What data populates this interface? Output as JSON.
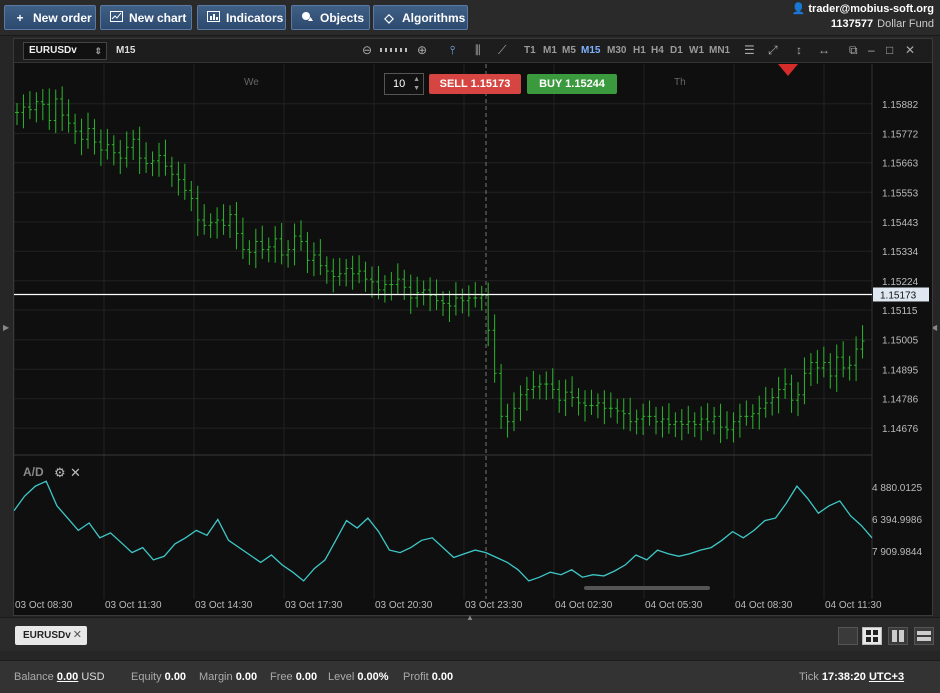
{
  "toolbar": {
    "buttons": [
      {
        "label": "New order",
        "icon": "plus-icon"
      },
      {
        "label": "New chart",
        "icon": "chart-icon"
      },
      {
        "label": "Indicators",
        "icon": "indicators-icon"
      },
      {
        "label": "Objects",
        "icon": "objects-icon"
      },
      {
        "label": "Algorithms",
        "icon": "algorithms-icon"
      }
    ],
    "account": {
      "user": "trader@mobius-soft.org",
      "number": "1137577",
      "fund": "Dollar Fund"
    }
  },
  "chart": {
    "symbol": "EURUSDv",
    "timeframe": "M15",
    "timeframes": [
      "T1",
      "M1",
      "M5",
      "M15",
      "M30",
      "H1",
      "H4",
      "D1",
      "W1",
      "MN1"
    ],
    "active_timeframe": "M15",
    "day_labels": [
      "We",
      "Th"
    ],
    "trade": {
      "lots": "10",
      "sell_label": "SELL",
      "sell_price": "1.15173",
      "buy_label": "BUY",
      "buy_price": "1.15244"
    },
    "indicator": "A/D",
    "colors": {
      "bars": "#2db52d",
      "indicator": "#3ec7c7",
      "bid_line": "#ffffff",
      "sell": "#d64541",
      "buy": "#3c9a3e",
      "active_tf": "#7fb2ff"
    }
  },
  "chart_data": {
    "type": "bar",
    "title": "",
    "symbol": "EURUSDv",
    "timeframe": "M15",
    "price_axis_ticks": [
      "1.15882",
      "1.15772",
      "1.15663",
      "1.15553",
      "1.15443",
      "1.15334",
      "1.15224",
      "1.15115",
      "1.15005",
      "1.14895",
      "1.14786",
      "1.14676"
    ],
    "current_price": "1.15173",
    "ylim": [
      1.1458,
      1.1603
    ],
    "x_axis_ticks": [
      "03 Oct 08:30",
      "03 Oct 11:30",
      "03 Oct 14:30",
      "03 Oct 17:30",
      "03 Oct 20:30",
      "03 Oct 23:30",
      "04 Oct 02:30",
      "04 Oct 05:30",
      "04 Oct 08:30",
      "04 Oct 11:30"
    ],
    "close_series": [
      1.1585,
      1.1587,
      1.1586,
      1.1589,
      1.1588,
      1.1582,
      1.159,
      1.1584,
      1.1581,
      1.1578,
      1.1575,
      1.1579,
      1.1574,
      1.1571,
      1.1573,
      1.157,
      1.1568,
      1.1572,
      1.1575,
      1.1568,
      1.1566,
      1.1567,
      1.1569,
      1.1565,
      1.1562,
      1.156,
      1.1556,
      1.1553,
      1.1545,
      1.1543,
      1.1544,
      1.1545,
      1.1543,
      1.1547,
      1.154,
      1.1534,
      1.1533,
      1.1537,
      1.1534,
      1.1535,
      1.1538,
      1.1532,
      1.1534,
      1.1539,
      1.1537,
      1.153,
      1.1532,
      1.1528,
      1.1526,
      1.1524,
      1.1525,
      1.1527,
      1.1525,
      1.1526,
      1.1523,
      1.1522,
      1.1519,
      1.1521,
      1.1521,
      1.1523,
      1.152,
      1.1516,
      1.1518,
      1.1519,
      1.1517,
      1.1515,
      1.1514,
      1.1513,
      1.1516,
      1.1515,
      1.1516,
      1.1516,
      1.1517,
      1.1504,
      1.1488,
      1.1472,
      1.147,
      1.1475,
      1.148,
      1.1482,
      1.1483,
      1.1484,
      1.1484,
      1.1482,
      1.1478,
      1.1481,
      1.1479,
      1.1477,
      1.1476,
      1.1476,
      1.1477,
      1.1475,
      1.1475,
      1.1474,
      1.1473,
      1.147,
      1.1471,
      1.1472,
      1.1472,
      1.147,
      1.1471,
      1.1469,
      1.147,
      1.1469,
      1.147,
      1.1469,
      1.1471,
      1.147,
      1.1472,
      1.1468,
      1.1467,
      1.147,
      1.1472,
      1.1472,
      1.1473,
      1.1475,
      1.1477,
      1.1479,
      1.1482,
      1.1484,
      1.1478,
      1.148,
      1.1488,
      1.1492,
      1.149,
      1.1492,
      1.1487,
      1.1494,
      1.149,
      1.1491,
      1.1497,
      1.15
    ],
    "indicator": {
      "name": "A/D",
      "axis_ticks": [
        "4 880.0125",
        "6 394.9986",
        "7 909.9844"
      ],
      "values": [
        0.62,
        0.74,
        0.82,
        0.86,
        0.66,
        0.56,
        0.46,
        0.52,
        0.4,
        0.44,
        0.36,
        0.28,
        0.32,
        0.22,
        0.25,
        0.35,
        0.4,
        0.46,
        0.42,
        0.55,
        0.38,
        0.32,
        0.26,
        0.2,
        0.26,
        0.18,
        0.12,
        0.05,
        0.15,
        0.22,
        0.38,
        0.54,
        0.48,
        0.56,
        0.45,
        0.3,
        0.28,
        0.32,
        0.38,
        0.4,
        0.32,
        0.24,
        0.27,
        0.3,
        0.28,
        0.24,
        0.2,
        0.14,
        0.05,
        0.08,
        0.12,
        0.1,
        0.14,
        0.08,
        0.1,
        0.09,
        0.13,
        0.18,
        0.26,
        0.22,
        0.3,
        0.27,
        0.25,
        0.27,
        0.3,
        0.32,
        0.38,
        0.45,
        0.4,
        0.46,
        0.54,
        0.56,
        0.68,
        0.82,
        0.72,
        0.6,
        0.66,
        0.7,
        0.58,
        0.5,
        0.4
      ]
    }
  },
  "tabs": [
    {
      "label": "EURUSDv"
    }
  ],
  "statusbar": {
    "balance_label": "Balance",
    "balance": "0.00",
    "currency": "USD",
    "equity_label": "Equity",
    "equity": "0.00",
    "margin_label": "Margin",
    "margin": "0.00",
    "free_label": "Free",
    "free": "0.00",
    "level_label": "Level",
    "level": "0.00%",
    "profit_label": "Profit",
    "profit": "0.00",
    "tick_label": "Tick",
    "tick_time": "17:38:20",
    "timezone": "UTC+3"
  }
}
